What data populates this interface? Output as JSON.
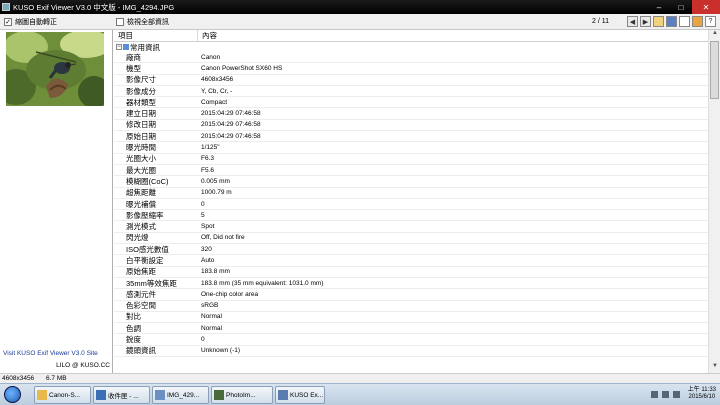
{
  "window": {
    "title": "KUSO Exif Viewer V3.0 中文版 - IMG_4294.JPG",
    "minimize": "–",
    "maximize": "□",
    "close": "✕"
  },
  "toolbar": {
    "auto_rotate_label": "縮圖自動轉正",
    "auto_rotate_checked": "✓",
    "show_all_label": "檢視全部資訊",
    "pager": "2 / 11",
    "buttons": [
      "prev-icon",
      "next-icon",
      "open-folder-icon",
      "save-icon",
      "copy-icon",
      "settings-icon",
      "help-icon"
    ]
  },
  "left_panel": {
    "site_link": "Visit KUSO Exif Viewer V3.0 Site",
    "credit": "LILO @ KUSO.CC"
  },
  "table": {
    "col_key": "項目",
    "col_value": "內容",
    "group_label": "常用資訊",
    "group_toggle": "−",
    "rows": [
      {
        "k": "廠商",
        "v": "Canon"
      },
      {
        "k": "機型",
        "v": "Canon PowerShot SX60 HS"
      },
      {
        "k": "影像尺寸",
        "v": "4608x3456"
      },
      {
        "k": "影像成分",
        "v": "Y, Cb, Cr, -"
      },
      {
        "k": "器材類型",
        "v": "Compact"
      },
      {
        "k": "建立日期",
        "v": "2015:04:29 07:46:58"
      },
      {
        "k": "修改日期",
        "v": "2015:04:29 07:46:58"
      },
      {
        "k": "原始日期",
        "v": "2015:04:29 07:46:58"
      },
      {
        "k": "曝光時間",
        "v": "1/125\""
      },
      {
        "k": "光圈大小",
        "v": "F6.3"
      },
      {
        "k": "最大光圈",
        "v": "F5.6"
      },
      {
        "k": "模糊圈(CoC)",
        "v": "0.005 mm"
      },
      {
        "k": "超焦距離",
        "v": "1000.79 m"
      },
      {
        "k": "曝光補償",
        "v": "0"
      },
      {
        "k": "影像壓縮率",
        "v": "5"
      },
      {
        "k": "測光模式",
        "v": "Spot"
      },
      {
        "k": "閃光燈",
        "v": "Off, Did not fire"
      },
      {
        "k": "ISO感光數值",
        "v": "320"
      },
      {
        "k": "白平衡設定",
        "v": "Auto"
      },
      {
        "k": "原始焦距",
        "v": "183.8 mm"
      },
      {
        "k": "35mm等效焦距",
        "v": "183.8 mm (35 mm equivalent: 1031.0 mm)"
      },
      {
        "k": "感測元件",
        "v": "One-chip color area"
      },
      {
        "k": "色彩空間",
        "v": "sRGB"
      },
      {
        "k": "對比",
        "v": "Normal"
      },
      {
        "k": "色調",
        "v": "Normal"
      },
      {
        "k": "銳度",
        "v": "0"
      },
      {
        "k": "鏡頭資訊",
        "v": "Unknown (-1)"
      }
    ]
  },
  "statusbar": {
    "dimensions": "4608x3456",
    "filesize": "6.7 MB"
  },
  "taskbar": {
    "items": [
      {
        "label": "Canon-S...",
        "icon": "folder-icon",
        "color": "#e8b84a"
      },
      {
        "label": "收件匣 - ...",
        "icon": "mail-icon",
        "color": "#3b6fb6"
      },
      {
        "label": "IMG_429...",
        "icon": "image-icon",
        "color": "#6a8fc0"
      },
      {
        "label": "PhotoIm...",
        "icon": "photo-app-icon",
        "color": "#4a6a3a"
      },
      {
        "label": "KUSO Ex...",
        "icon": "kuso-app-icon",
        "color": "#5b7cb0"
      }
    ],
    "time": "上午 11:33",
    "date": "2015/6/10"
  }
}
